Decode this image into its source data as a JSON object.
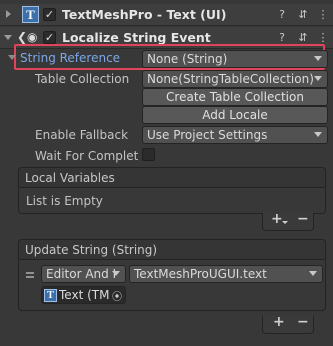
{
  "component1": {
    "title": "TextMeshPro - Text (UI)",
    "enabled_mark": "✓"
  },
  "component2": {
    "title": "Localize String Event",
    "enabled_mark": "✓"
  },
  "fields": {
    "string_reference_label": "String Reference",
    "string_reference_value": "None (String)",
    "table_collection_label": "Table Collection",
    "table_collection_value": "None(StringTableCollection)",
    "create_table_collection": "Create Table Collection",
    "add_locale": "Add Locale",
    "enable_fallback_label": "Enable Fallback",
    "enable_fallback_value": "Use Project Settings",
    "wait_for_completion_label": "Wait For Completio"
  },
  "local_variables": {
    "header": "Local Variables",
    "empty_text": "List is Empty"
  },
  "update_string": {
    "header": "Update String (String)",
    "runtime_value": "Editor And I",
    "function_value": "TextMeshProUGUI.text",
    "target_object": "Text (TM"
  },
  "colors": {
    "highlight": "#e0435a",
    "reference_label": "#7aa7e8"
  }
}
